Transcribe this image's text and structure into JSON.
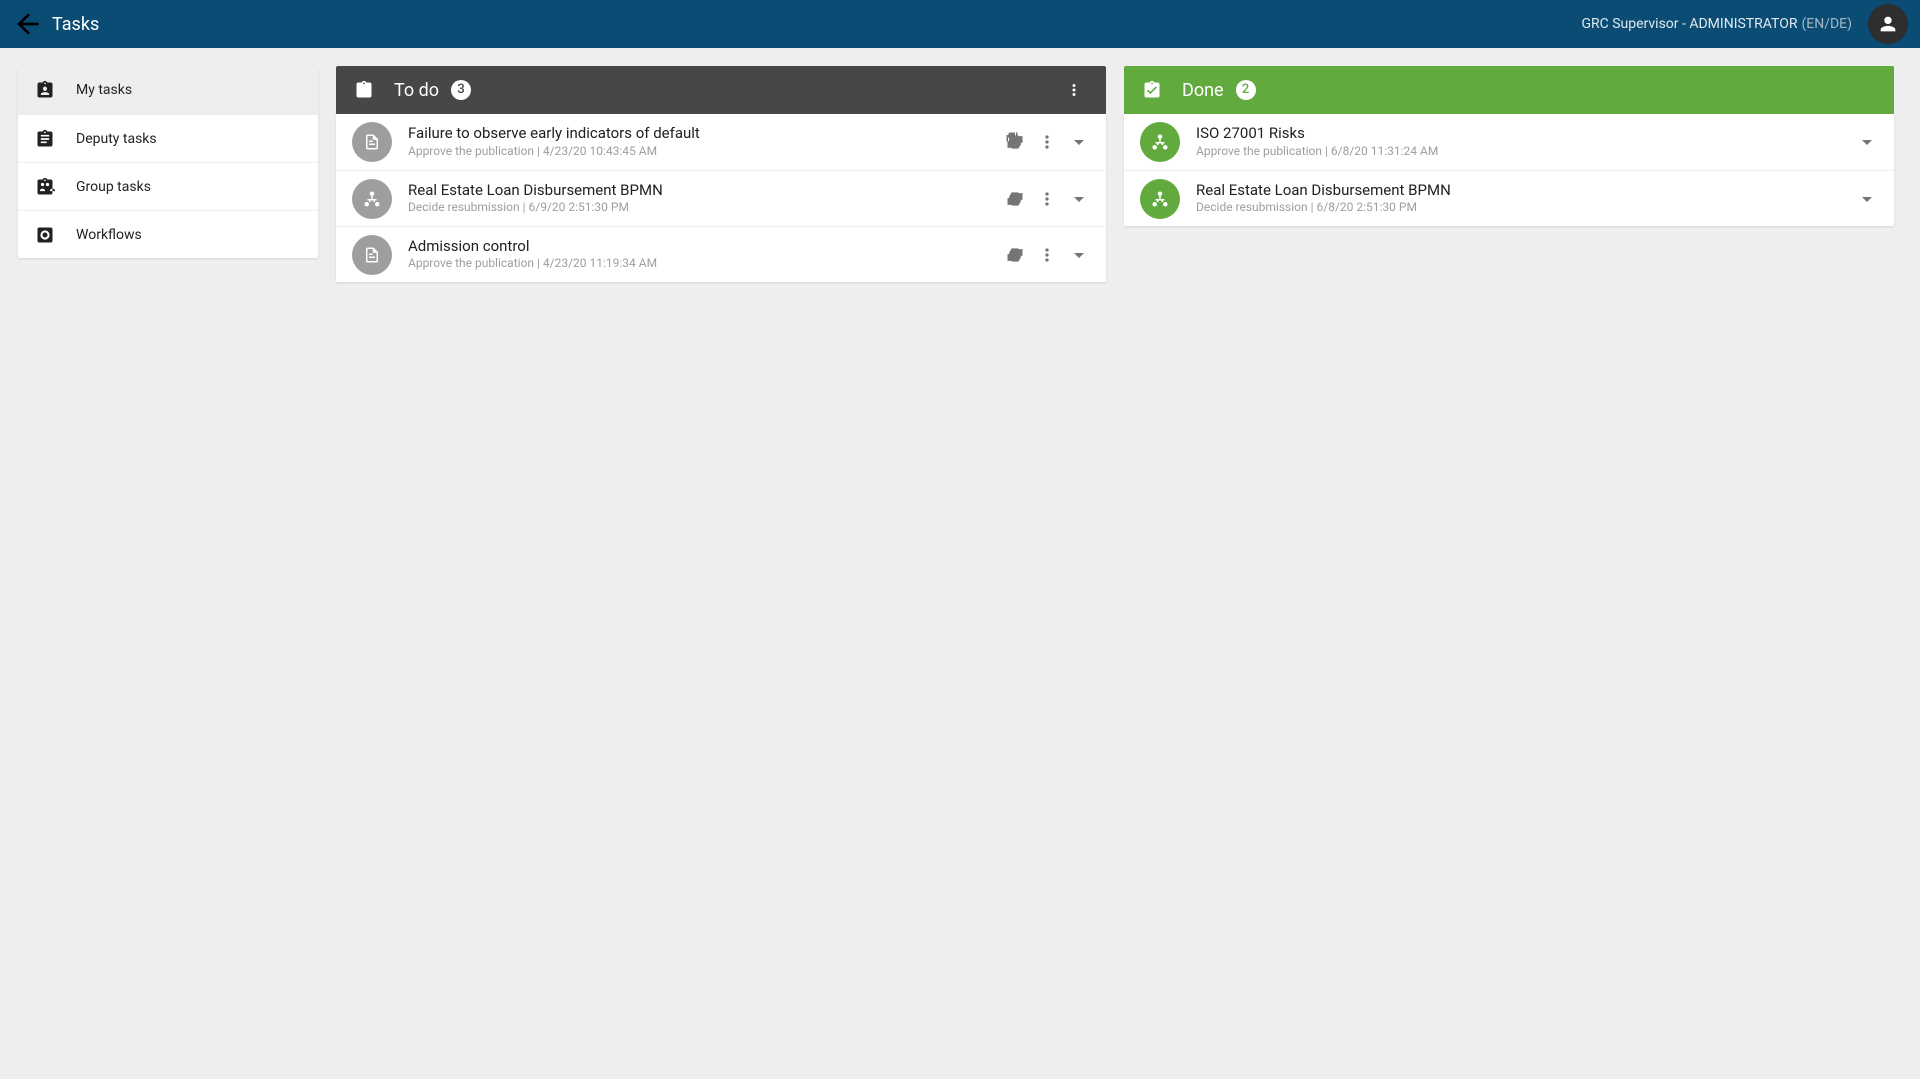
{
  "header": {
    "title": "Tasks",
    "user_role": "GRC Supervisor - ADMINISTRATOR",
    "user_lang": "(EN/DE)"
  },
  "sidebar": {
    "items": [
      {
        "label": "My tasks",
        "icon": "assignment-ind"
      },
      {
        "label": "Deputy tasks",
        "icon": "assignment"
      },
      {
        "label": "Group tasks",
        "icon": "assignment-group"
      },
      {
        "label": "Workflows",
        "icon": "settings-app"
      }
    ],
    "active_index": 0
  },
  "columns": {
    "todo": {
      "title": "To do",
      "count": "3",
      "tasks": [
        {
          "icon": "document",
          "title": "Failure to observe early indicators of default",
          "subtitle": "Approve the publication | 4/23/20 10:43:45 AM"
        },
        {
          "icon": "hierarchy",
          "title": "Real Estate Loan Disbursement BPMN",
          "subtitle": "Decide resubmission | 6/9/20 2:51:30 PM"
        },
        {
          "icon": "document",
          "title": "Admission control",
          "subtitle": "Approve the publication | 4/23/20 11:19:34 AM"
        }
      ]
    },
    "done": {
      "title": "Done",
      "count": "2",
      "tasks": [
        {
          "icon": "hierarchy",
          "title": "ISO 27001 Risks",
          "subtitle": "Approve the publication | 6/8/20 11:31:24 AM"
        },
        {
          "icon": "hierarchy",
          "title": "Real Estate Loan Disbursement BPMN",
          "subtitle": "Decide resubmission | 6/8/20 2:51:30 PM"
        }
      ]
    }
  }
}
